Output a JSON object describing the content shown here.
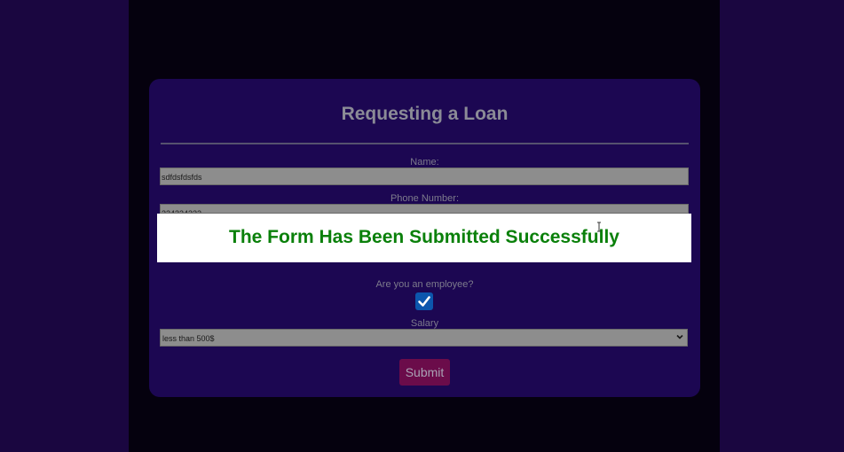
{
  "form": {
    "title": "Requesting a Loan",
    "name_label": "Name:",
    "name_value": "sdfdsfdsfds",
    "phone_label": "Phone Number:",
    "phone_value": "324324322",
    "employee_label": "Are you an employee?",
    "employee_checked": true,
    "salary_label": "Salary",
    "salary_selected": "less than 500$",
    "submit_label": "Submit"
  },
  "toast": {
    "message": "The Form Has Been Submitted Successfully"
  },
  "colors": {
    "page_bg": "#1a0640",
    "card_bg": "#1c0752",
    "success_text": "#0a800a",
    "submit_bg": "#6b0c4a",
    "checkbox_bg": "#0c56ad"
  },
  "icons": {
    "check": "check-icon",
    "chevron": "chevron-down-icon",
    "cursor": "text-cursor-icon"
  }
}
